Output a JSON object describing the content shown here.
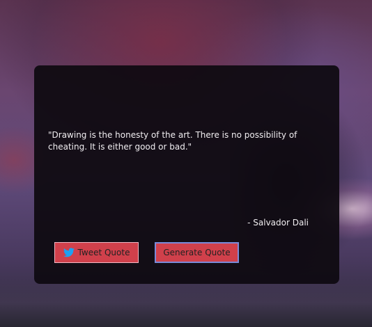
{
  "quote": {
    "text": "\"Drawing is the honesty of the art. There is no possibility of cheating. It is either good or bad.\"",
    "author": "- Salvador Dali"
  },
  "buttons": {
    "tweet_label": "Tweet Quote",
    "generate_label": "Generate Quote"
  },
  "icons": {
    "tweet": "twitter-icon"
  },
  "colors": {
    "button_bg": "#d0404b",
    "card_bg": "#0e0a10",
    "twitter_blue": "#1da1f2"
  }
}
